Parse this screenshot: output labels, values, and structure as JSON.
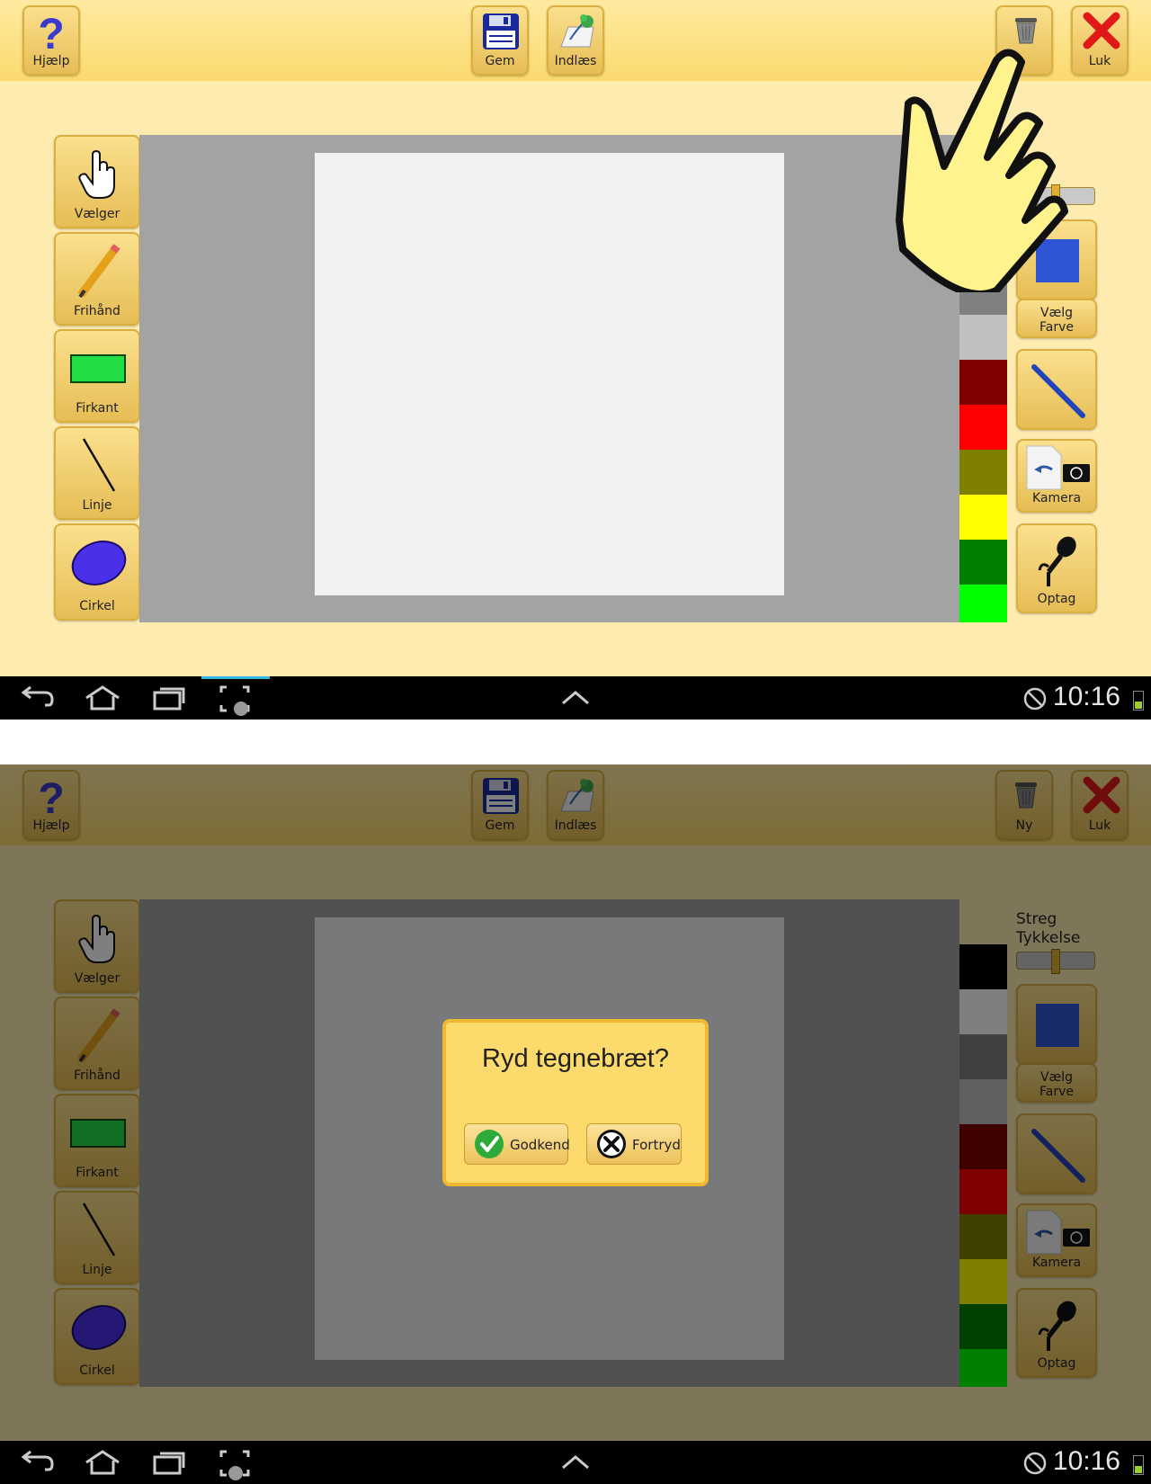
{
  "toolbar": {
    "help_label": "Hjælp",
    "save_label": "Gem",
    "load_label": "Indlæs",
    "new_label": "Ny",
    "close_label": "Luk"
  },
  "tools": [
    {
      "label": "Vælger",
      "icon": "hand-pointer-icon"
    },
    {
      "label": "Frihånd",
      "icon": "pencil-icon"
    },
    {
      "label": "Firkant",
      "icon": "rectangle-icon"
    },
    {
      "label": "Linje",
      "icon": "line-icon"
    },
    {
      "label": "Cirkel",
      "icon": "ellipse-icon"
    }
  ],
  "right_panel": {
    "stroke_title_line1": "Streg",
    "stroke_title_line2": "Tykkelse",
    "pick_color_line1": "Vælg",
    "pick_color_line2": "Farve",
    "camera_label": "Kamera",
    "record_label": "Optag",
    "selected_color": "#2f55d4"
  },
  "palette": [
    "#000000",
    "#ffffff",
    "#808080",
    "#c0c0c0",
    "#800000",
    "#ff0000",
    "#808000",
    "#ffff00",
    "#008000",
    "#00ff00"
  ],
  "dialog": {
    "message": "Ryd tegnebræt?",
    "confirm_label": "Godkend",
    "cancel_label": "Fortryd"
  },
  "statusbar": {
    "time": "10:16"
  },
  "colors": {
    "accent": "#fdda6c",
    "background": "#feebb0"
  }
}
